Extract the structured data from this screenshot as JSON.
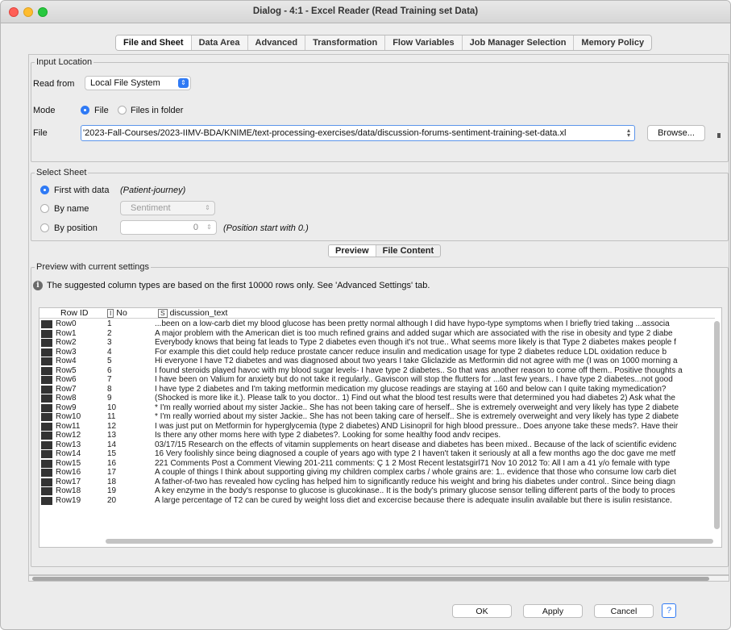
{
  "window": {
    "title": "Dialog - 4:1 - Excel Reader (Read Training set Data)"
  },
  "tabs": [
    {
      "label": "File and Sheet",
      "active": true
    },
    {
      "label": "Data Area",
      "active": false
    },
    {
      "label": "Advanced",
      "active": false
    },
    {
      "label": "Transformation",
      "active": false
    },
    {
      "label": "Flow Variables",
      "active": false
    },
    {
      "label": "Job Manager Selection",
      "active": false
    },
    {
      "label": "Memory Policy",
      "active": false
    }
  ],
  "input_location": {
    "group_label": "Input Location",
    "read_from_label": "Read from",
    "read_from_value": "Local File System",
    "mode_label": "Mode",
    "mode_file": "File",
    "mode_folder": "Files in folder",
    "file_label": "File",
    "file_value": "'2023-Fall-Courses/2023-IIMV-BDA/KNIME/text-processing-exercises/data/discussion-forums-sentiment-training-set-data.xl",
    "browse_label": "Browse..."
  },
  "select_sheet": {
    "group_label": "Select Sheet",
    "first_with_data": "First with data",
    "first_with_data_hint": "(Patient-journey)",
    "by_name": "By name",
    "by_name_value": "Sentiment",
    "by_position": "By position",
    "position_value": "0",
    "position_hint": "(Position start with 0.)"
  },
  "preview_tabs": {
    "preview": "Preview",
    "file_content": "File Content"
  },
  "preview": {
    "group_label": "Preview with current settings",
    "info_text": "The suggested column types are based on the first 10000 rows only. See 'Advanced Settings' tab.",
    "columns": {
      "row_id": "Row ID",
      "no_type": "I",
      "no": "No",
      "text_type": "S",
      "text": "discussion_text"
    },
    "rows": [
      {
        "id": "Row0",
        "no": "1",
        "text": "...been on a low-carb diet my blood glucose has been pretty normal  although I did have hypo-type symptoms when I briefly tried taking ...associa"
      },
      {
        "id": "Row1",
        "no": "2",
        "text": "A major problem with the American diet is too much refined grains and added sugar  which are associated with the rise in obesity and type 2 diabe"
      },
      {
        "id": "Row2",
        "no": "3",
        "text": "Everybody knows that being fat leads to Type 2 diabetes even though it's not true.. What seems more likely is that Type 2 diabetes makes people f"
      },
      {
        "id": "Row3",
        "no": "4",
        "text": "For example  this diet could help reduce prostate cancer  reduce insulin and medication usage for type 2 diabetes  reduce LDL oxidation  reduce b"
      },
      {
        "id": "Row4",
        "no": "5",
        "text": "Hi everyone I have T2 diabetes and was diagnosed about two years I take Gliclazide as Metformin did not agree with me (I was on 1000 morning a"
      },
      {
        "id": "Row5",
        "no": "6",
        "text": "I found steroids played havoc with my blood sugar levels- I have type 2 diabetes.. So that was another reason to come off them.. Positive thoughts a"
      },
      {
        "id": "Row6",
        "no": "7",
        "text": "I have been on Valium for anxiety but do not take it regularly.. Gaviscon will stop the flutters for ...last few years.. I have type 2 diabetes...not good"
      },
      {
        "id": "Row7",
        "no": "8",
        "text": "I have type 2 diabetes and I'm taking metformin medication my glucose readings are staying at 160 and below can I quite taking mymedication?"
      },
      {
        "id": "Row8",
        "no": "9",
        "text": "(Shocked is more like it.). Please talk to you doctor.. 1) Find out what the blood test results were that determined you had diabetes  2) Ask what the"
      },
      {
        "id": "Row9",
        "no": "10",
        "text": "* I'm really worried about my sister  Jackie.. She has not been taking care of herself.. She is extremely overweight and very likely has type 2 diabete"
      },
      {
        "id": "Row10",
        "no": "11",
        "text": "* I'm really worried about my sister  Jackie.. She has not been taking care of herself.. She is extremely overweight and very likely has type 2 diabete"
      },
      {
        "id": "Row11",
        "no": "12",
        "text": "I was just put on Metformin for hyperglycemia (type 2 diabetes) AND Lisinopril for high blood pressure.. Does anyone take these meds?. Have their"
      },
      {
        "id": "Row12",
        "no": "13",
        "text": "Is there any other moms here with type 2 diabetes?. Looking for some healthy food andv recipes."
      },
      {
        "id": "Row13",
        "no": "14",
        "text": "03/17/15 Research on the effects of vitamin supplements on heart disease and diabetes has been mixed.. Because of the lack of scientific evidenc"
      },
      {
        "id": "Row14",
        "no": "15",
        "text": "16 Very foolishly since being diagnosed a couple of years ago with type 2 I haven't taken it seriously at all  a few months ago the doc gave me metf"
      },
      {
        "id": "Row15",
        "no": "16",
        "text": "221 Comments Post a Comment Viewing 201-211 comments: Ç 1 2 Most Recent lestatsgirl71 Nov 10  2012 To: All I am a 41 y/o female with type"
      },
      {
        "id": "Row16",
        "no": "17",
        "text": "A couple of things I think about supporting giving my children complex carbs / whole grains are: 1.. evidence that those who consume low carb diet"
      },
      {
        "id": "Row17",
        "no": "18",
        "text": "A father-of-two has revealed how cycling has helped him to significantly reduce his weight and bring his diabetes under control.. Since being diagn"
      },
      {
        "id": "Row18",
        "no": "19",
        "text": "A key enzyme in the body's response to glucose is glucokinase.. It is the body's primary glucose sensor  telling different parts of the body to proces"
      },
      {
        "id": "Row19",
        "no": "20",
        "text": "A large percentage of T2 can be cured by weight loss  diet  and excercise because there is adequate insulin available but there is isulin resistance."
      }
    ]
  },
  "footer": {
    "ok": "OK",
    "apply": "Apply",
    "cancel": "Cancel",
    "help": "?"
  }
}
